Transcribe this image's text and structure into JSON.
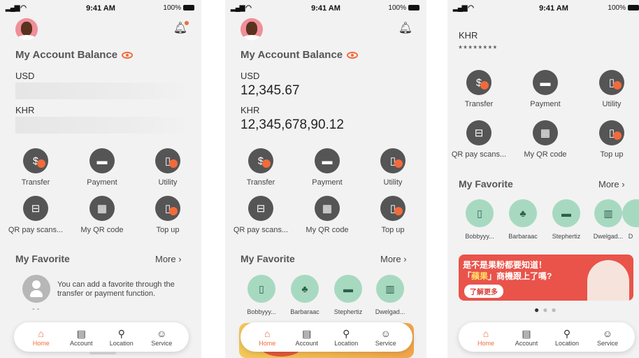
{
  "status": {
    "time": "9:41 AM",
    "battery": "100%"
  },
  "balance": {
    "title": "My Account Balance",
    "usd_label": "USD",
    "khr_label": "KHR",
    "usd_value": "12,345.67",
    "khr_value": "12,345,678,90.12",
    "hidden_value": "********"
  },
  "services": [
    {
      "label": "Transfer",
      "icon": "transfer-icon",
      "glyph": "$"
    },
    {
      "label": "Payment",
      "icon": "wallet-icon",
      "glyph": "▬"
    },
    {
      "label": "Utility",
      "icon": "utility-icon",
      "glyph": "▯"
    },
    {
      "label": "QR pay scans...",
      "icon": "qr-scan-icon",
      "glyph": "⊟"
    },
    {
      "label": "My QR code",
      "icon": "qr-code-icon",
      "glyph": "▦"
    },
    {
      "label": "Top up",
      "icon": "topup-icon",
      "glyph": "▯"
    }
  ],
  "favorite": {
    "title": "My Favorite",
    "more": "More",
    "empty_text": "You can add a favorite through the transfer or payment function.",
    "empty_dash": "- -",
    "items": [
      {
        "name": "Bobbyyy...",
        "icon": "phone-icon",
        "glyph": "▯"
      },
      {
        "name": "Barbaraac",
        "icon": "tree-icon",
        "glyph": "♣"
      },
      {
        "name": "Stephertiz",
        "icon": "card-icon",
        "glyph": "▬"
      },
      {
        "name": "Dwelgad...",
        "icon": "building-icon",
        "glyph": "▥"
      },
      {
        "name": "D",
        "icon": "generic-icon",
        "glyph": ""
      }
    ]
  },
  "banner": {
    "line1": "是不是果粉都要知道！",
    "line2_pre": "「",
    "line2_highlight": "蘋果",
    "line2_post": "」商機跟上了嗎?",
    "cta": "了解更多"
  },
  "tabs": [
    {
      "label": "Home",
      "icon": "home-icon",
      "glyph": "⌂"
    },
    {
      "label": "Account",
      "icon": "account-icon",
      "glyph": "▤"
    },
    {
      "label": "Location",
      "icon": "location-icon",
      "glyph": "⚲"
    },
    {
      "label": "Service",
      "icon": "service-icon",
      "glyph": "☺"
    }
  ],
  "colors": {
    "accent": "#f26b3a",
    "favorite_bg": "#a7d9c1",
    "service_icon_bg": "#555555"
  }
}
